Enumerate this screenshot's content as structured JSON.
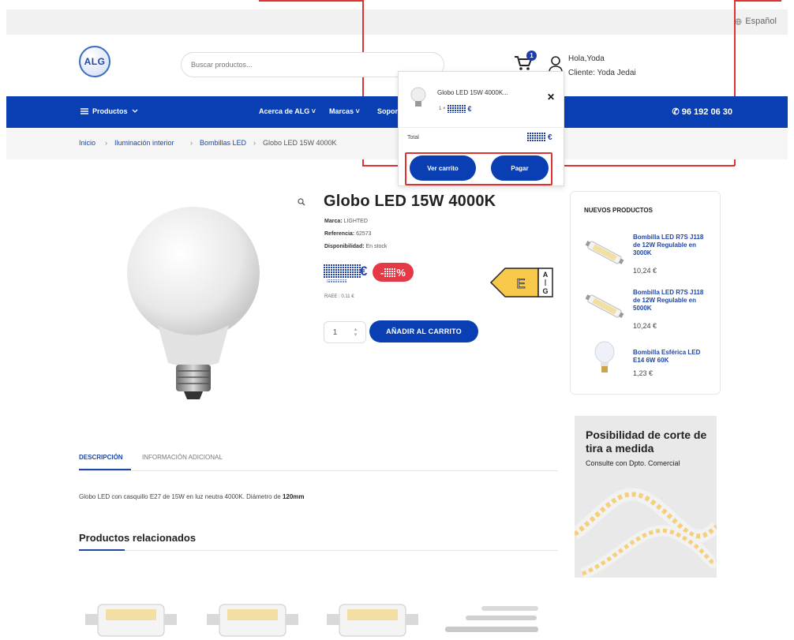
{
  "topbar": {
    "language": "Español"
  },
  "header": {
    "logo_text": "ALG",
    "search_placeholder": "Buscar productos...",
    "cart_count": "1",
    "greeting": "Hola,Yoda",
    "client": "Cliente: Yoda Jedai"
  },
  "nav": {
    "products": "Productos",
    "about": "Acerca de ALG",
    "brands": "Marcas",
    "support": "Soport",
    "phone": "96 192 06 30"
  },
  "breadcrumb": {
    "items": [
      "Inicio",
      "Iluminación interior",
      "Bombillas LED"
    ],
    "current": "Globo LED 15W 4000K"
  },
  "product": {
    "title": "Globo LED 15W 4000K",
    "brand_label": "Marca:",
    "brand": "LIGHTED",
    "ref_label": "Referencia:",
    "ref": "62573",
    "avail_label": "Disponibilidad:",
    "avail": "En stock",
    "currency": "€",
    "discount_sign": "-",
    "discount_pct": "%",
    "raee": "RAEE : 0.11 €",
    "energy_class": "E",
    "energy_top": "A",
    "energy_bottom": "G",
    "qty": "1",
    "add_to_cart": "AÑADIR AL CARRITO"
  },
  "sidebar": {
    "title": "NUEVOS PRODUCTOS",
    "items": [
      {
        "name": "Bombilla LED R7S J118 de 12W Regulable en 3000K",
        "price": "10,24 €"
      },
      {
        "name": "Bombilla LED R7S J118 de 12W Regulable en 5000K",
        "price": "10,24 €"
      },
      {
        "name": "Bombilla Esférica LED E14 6W 60K",
        "price": "1,23 €"
      }
    ]
  },
  "promo": {
    "title": "Posibilidad de corte de tira a medida",
    "subtitle": "Consulte con Dpto. Comercial"
  },
  "tabs": {
    "description": "DESCRIPCIÓN",
    "additional": "INFORMACIÓN ADICIONAL"
  },
  "description": {
    "text": "Globo LED con casquillo E27 de 15W en luz neutra 4000K. Diámetro de ",
    "bold": "120mm"
  },
  "related": {
    "title": "Productos relacionados"
  },
  "minicart": {
    "item_name": "Globo LED 15W 4000K...",
    "item_qty": "1 ×",
    "currency": "€",
    "total_label": "Total",
    "view_cart": "Ver carrito",
    "pay": "Pagar"
  },
  "colors": {
    "brand_blue": "#0a3fb3",
    "discount_red": "#e53946",
    "highlight_red": "#d33333"
  }
}
